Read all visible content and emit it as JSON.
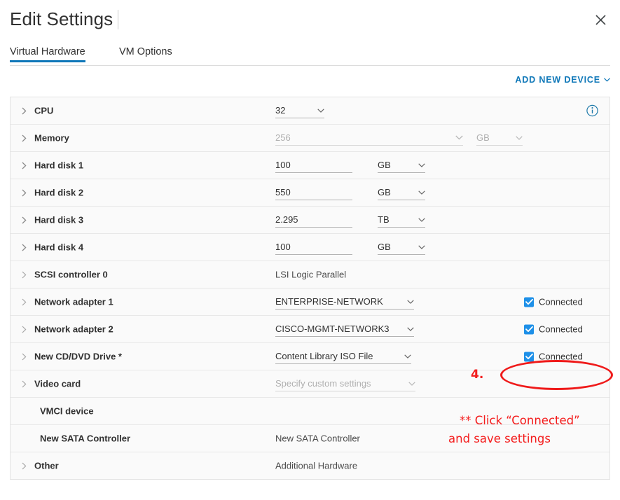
{
  "dialog": {
    "title": "Edit Settings",
    "close_icon": "close-icon"
  },
  "tabs": [
    {
      "label": "Virtual Hardware",
      "active": true
    },
    {
      "label": "VM Options",
      "active": false
    }
  ],
  "toolbar": {
    "add_new_device_label": "ADD NEW DEVICE",
    "add_new_device_chevron": "⌄"
  },
  "colors": {
    "accent_blue": "#0e77b8",
    "checkbox_blue": "#1e90e8",
    "annotation_red": "#f41c1c",
    "row_background": "#fafafa"
  },
  "hardware_rows": [
    {
      "label": "CPU",
      "value": "32",
      "unit": null,
      "info": true,
      "connected_label": null
    },
    {
      "label": "Memory",
      "value": "256",
      "unit": "GB",
      "disabled": true,
      "connected_label": null
    },
    {
      "label": "Hard disk 1",
      "value": "100",
      "unit": "GB",
      "connected_label": null
    },
    {
      "label": "Hard disk 2",
      "value": "550",
      "unit": "GB",
      "connected_label": null
    },
    {
      "label": "Hard disk 3",
      "value": "2.295",
      "unit": "TB",
      "connected_label": null
    },
    {
      "label": "Hard disk 4",
      "value": "100",
      "unit": "GB",
      "connected_label": null
    },
    {
      "label": "SCSI controller 0",
      "value": "LSI Logic Parallel",
      "unit": null,
      "connected_label": null
    },
    {
      "label": "Network adapter 1",
      "value": "ENTERPRISE-NETWORK",
      "unit": null,
      "connected_label": "Connected",
      "connected": true
    },
    {
      "label": "Network adapter 2",
      "value": "CISCO-MGMT-NETWORK3",
      "unit": null,
      "connected_label": "Connected",
      "connected": true
    },
    {
      "label": "New CD/DVD Drive *",
      "value": "Content Library ISO File",
      "unit": null,
      "connected_label": "Connected",
      "connected": true
    },
    {
      "label": "Video card",
      "value": "Specify custom settings",
      "unit": null,
      "disabled": true,
      "connected_label": null
    },
    {
      "label": "VMCI device",
      "value": "",
      "unit": null,
      "connected_label": null
    },
    {
      "label": "New SATA Controller",
      "value": "New SATA Controller",
      "unit": null,
      "connected_label": null
    },
    {
      "label": "Other",
      "value": "Additional Hardware",
      "unit": null,
      "connected_label": null
    }
  ],
  "annotations": {
    "step_number": "4.",
    "note_line1": "** Click “Connected”",
    "note_line2": "and save settings"
  }
}
